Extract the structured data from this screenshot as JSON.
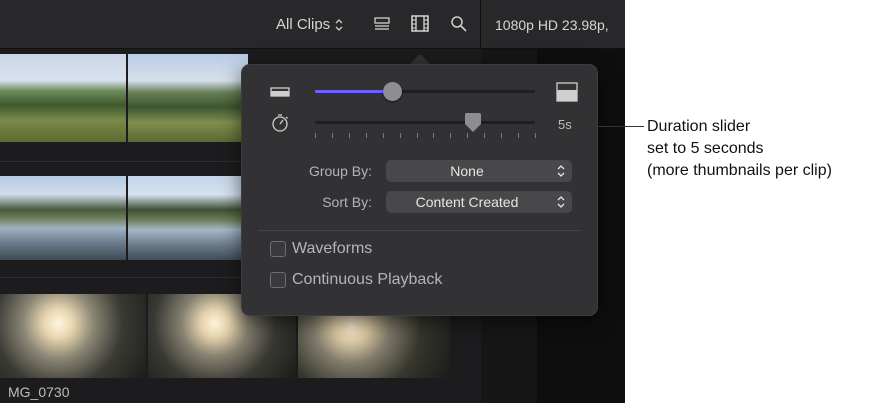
{
  "toolbar": {
    "clips_filter": "All Clips",
    "icons": [
      "clip-appearance-icon",
      "filmstrip-icon",
      "search-icon"
    ],
    "format": "1080p HD 23.98p,"
  },
  "browser": {
    "clip_name": "MG_0730"
  },
  "popover": {
    "zoom_slider": {
      "fraction": 0.35
    },
    "duration_slider": {
      "value_label": "5s",
      "fraction": 0.72
    },
    "group_by": {
      "label": "Group By:",
      "value": "None"
    },
    "sort_by": {
      "label": "Sort By:",
      "value": "Content Created"
    },
    "waveforms": {
      "label": "Waveforms",
      "checked": false
    },
    "continuous_playback": {
      "label": "Continuous Playback",
      "checked": false
    }
  },
  "callout": {
    "line1": "Duration slider",
    "line2": "set to 5 seconds",
    "line3": "(more thumbnails per clip)"
  },
  "colors": {
    "slider_accent": "#6c63ff",
    "app_background": "#1c1c1e",
    "popover_background": "#323235"
  }
}
